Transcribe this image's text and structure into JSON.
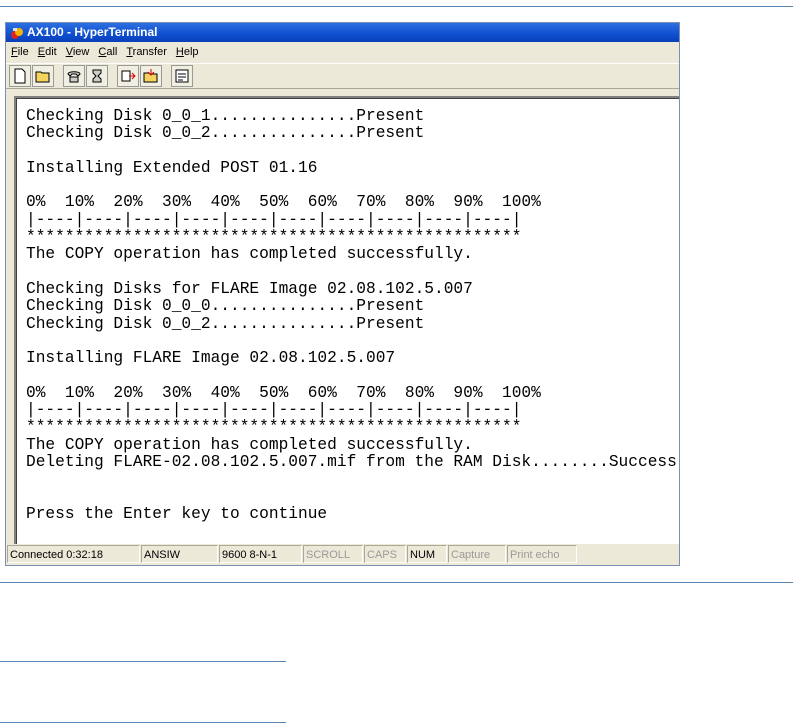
{
  "window": {
    "title": "AX100 - HyperTerminal"
  },
  "menu": [
    {
      "key": "F",
      "rest": "ile"
    },
    {
      "key": "E",
      "rest": "dit"
    },
    {
      "key": "V",
      "rest": "iew"
    },
    {
      "key": "C",
      "rest": "all"
    },
    {
      "key": "T",
      "rest": "ransfer"
    },
    {
      "key": "H",
      "rest": "elp"
    }
  ],
  "toolbar": {
    "buttons": [
      "new-file-icon",
      "open-folder-icon",
      "phone-icon",
      "disconnect-icon",
      "send-icon",
      "receive-icon",
      "properties-icon"
    ]
  },
  "terminal": {
    "lines": [
      "Checking Disk 0_0_1...............Present",
      "Checking Disk 0_0_2...............Present",
      "",
      "Installing Extended POST 01.16",
      "",
      "0%  10%  20%  30%  40%  50%  60%  70%  80%  90%  100%",
      "|----|----|----|----|----|----|----|----|----|----|",
      "***************************************************",
      "The COPY operation has completed successfully.",
      "",
      "Checking Disks for FLARE Image 02.08.102.5.007",
      "Checking Disk 0_0_0...............Present",
      "Checking Disk 0_0_2...............Present",
      "",
      "Installing FLARE Image 02.08.102.5.007",
      "",
      "0%  10%  20%  30%  40%  50%  60%  70%  80%  90%  100%",
      "|----|----|----|----|----|----|----|----|----|----|",
      "***************************************************",
      "The COPY operation has completed successfully.",
      "Deleting FLARE-02.08.102.5.007.mif from the RAM Disk........Success",
      "",
      "",
      "Press the Enter key to continue"
    ]
  },
  "status": {
    "connected": "Connected 0:32:18",
    "emulation": "ANSIW",
    "settings": "9600 8-N-1",
    "scroll": "SCROLL",
    "caps": "CAPS",
    "num": "NUM",
    "capture": "Capture",
    "print_echo": "Print echo"
  }
}
